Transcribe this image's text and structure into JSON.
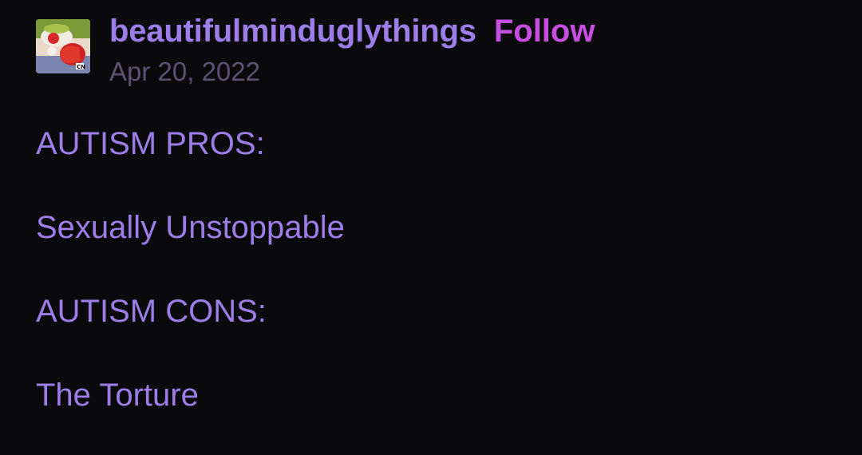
{
  "post": {
    "author": "beautifulminduglythings",
    "follow_label": "Follow",
    "date": "Apr 20, 2022",
    "avatar_icon": "cartoon-character-avatar",
    "body": [
      "AUTISM PROS:",
      "Sexually Unstoppable",
      "AUTISM CONS:",
      "The Torture"
    ]
  },
  "colors": {
    "background": "#0a090b",
    "blog_name": "#9d7de8",
    "follow": "#c64ee0",
    "date": "#5c5273",
    "body_text": "#9d7de8"
  }
}
